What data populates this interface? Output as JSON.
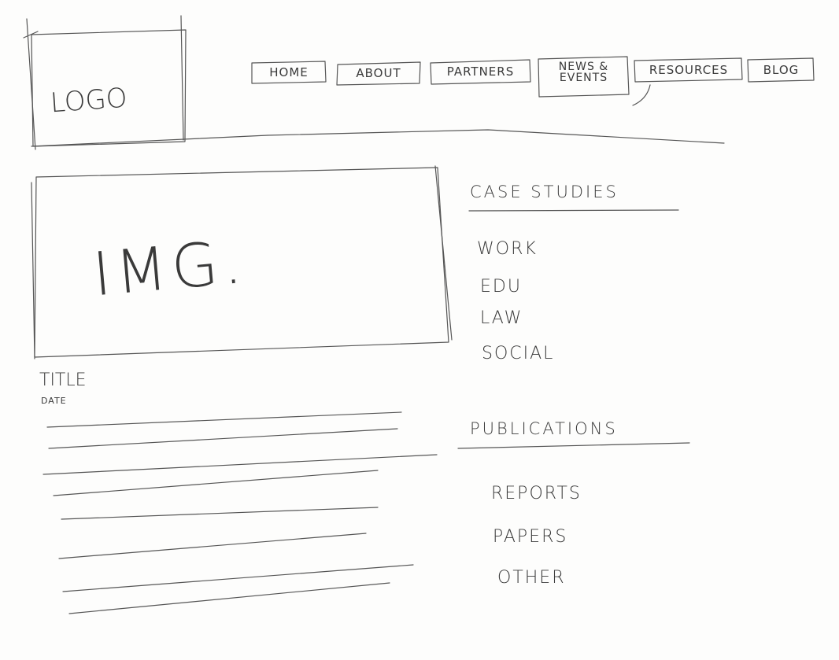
{
  "logo": {
    "label": "LOGO"
  },
  "nav": {
    "items": [
      {
        "label": "HOME"
      },
      {
        "label": "ABOUT"
      },
      {
        "label": "PARTNERS"
      },
      {
        "label_line1": "NEWS &",
        "label_line2": "EVENTS"
      },
      {
        "label": "RESOURCES"
      },
      {
        "label": "BLOG"
      }
    ]
  },
  "hero": {
    "label": "IMG."
  },
  "article": {
    "title": "TITLE",
    "date": "DATE"
  },
  "sidebar": {
    "case_studies": {
      "title": "CASE STUDIES",
      "items": [
        {
          "label": "WORK"
        },
        {
          "label": "EDU"
        },
        {
          "label": "LAW"
        },
        {
          "label": "SOCIAL"
        }
      ]
    },
    "publications": {
      "title": "PUBLICATIONS",
      "items": [
        {
          "label": "REPORTS"
        },
        {
          "label": "PAPERS"
        },
        {
          "label": "OTHER"
        }
      ]
    }
  }
}
